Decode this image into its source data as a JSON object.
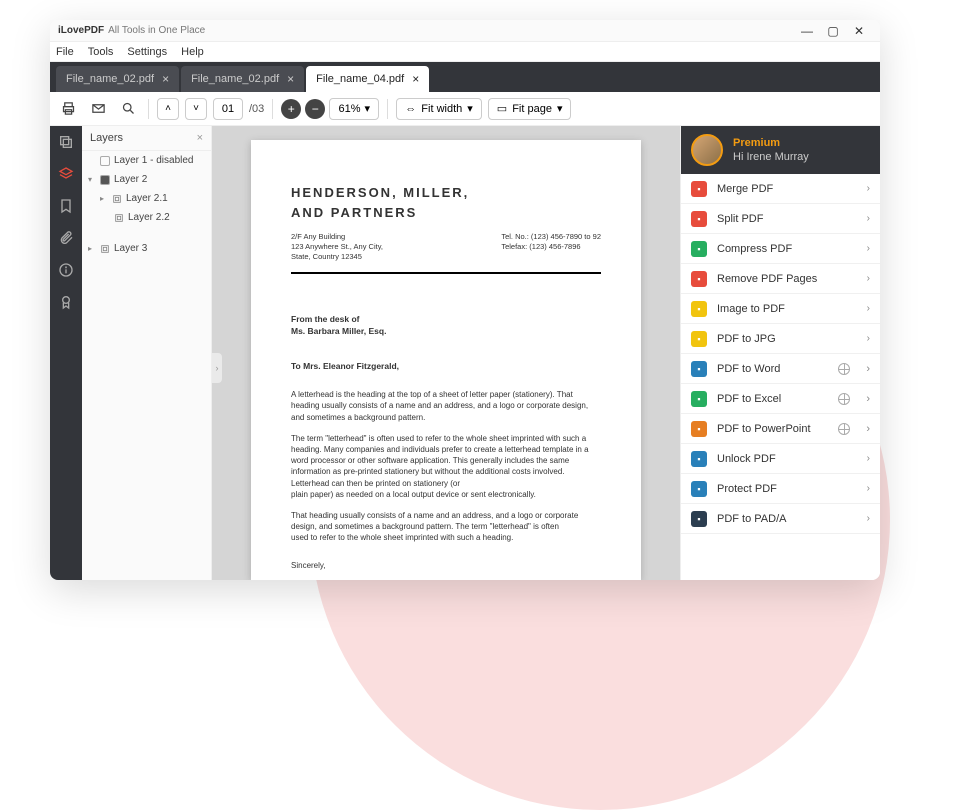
{
  "titlebar": {
    "app": "iLovePDF",
    "subtitle": "All Tools in One Place"
  },
  "menubar": [
    "File",
    "Tools",
    "Settings",
    "Help"
  ],
  "tabs": [
    {
      "label": "File_name_02.pdf",
      "active": false
    },
    {
      "label": "File_name_02.pdf",
      "active": false
    },
    {
      "label": "File_name_04.pdf",
      "active": true
    }
  ],
  "toolbar": {
    "page_current": "01",
    "page_total": "/03",
    "zoom": "61%",
    "fit_width": "Fit width",
    "fit_page": "Fit page"
  },
  "layers": {
    "title": "Layers",
    "items": [
      {
        "label": "Layer 1 - disabled",
        "level": 0,
        "checked": false,
        "expandable": false
      },
      {
        "label": "Layer 2",
        "level": 0,
        "checked": true,
        "expandable": true
      },
      {
        "label": "Layer 2.1",
        "level": 1,
        "checked": false,
        "icon": true,
        "expandable": true
      },
      {
        "label": "Layer 2.2",
        "level": 2,
        "checked": false,
        "icon": true,
        "expandable": false
      },
      {
        "label": "Layer 3",
        "level": 0,
        "checked": false,
        "icon": true,
        "expandable": true
      }
    ]
  },
  "document": {
    "h1": "HENDERSON, MILLER,",
    "h2": "AND PARTNERS",
    "addr_left": "2/F Any Building\n123 Anywhere St., Any City,\nState, Country 12345",
    "addr_right": "Tel. No.: (123) 456-7890 to 92\nTelefax: (123) 456-7896",
    "desk1": "From the desk of",
    "desk2": "Ms. Barbara Miller, Esq.",
    "to": "To Mrs. Eleanor Fitzgerald,",
    "p1": "A letterhead is the heading at the top of a sheet of letter paper (stationery). That heading usually consists of a name and an address, and a logo or corporate design, and sometimes a background pattern.",
    "p2": "The term \"letterhead\" is often used to refer to the whole sheet imprinted with such a heading. Many companies and individuals prefer to create a letterhead template in a word processor or other software application. This generally includes the same information as pre-printed stationery but without the additional costs involved. Letterhead can then be printed on stationery (or",
    "p3": "plain paper) as needed on a local output device or sent electronically.",
    "p4": "That heading usually consists of a name and an address, and a logo or corporate design, and sometimes a background pattern. The term \"letterhead\" is often",
    "p5": "used to refer to the whole sheet imprinted with such a heading.",
    "sign": "Sincerely,"
  },
  "user": {
    "premium": "Premium",
    "greeting": "Hi Irene Murray"
  },
  "tools": [
    {
      "label": "Merge PDF",
      "color": "#e74c3c",
      "globe": false
    },
    {
      "label": "Split PDF",
      "color": "#e74c3c",
      "globe": false
    },
    {
      "label": "Compress PDF",
      "color": "#27ae60",
      "globe": false
    },
    {
      "label": "Remove PDF Pages",
      "color": "#e74c3c",
      "globe": false
    },
    {
      "label": "Image to PDF",
      "color": "#f1c40f",
      "globe": false
    },
    {
      "label": "PDF to JPG",
      "color": "#f1c40f",
      "globe": false
    },
    {
      "label": "PDF to Word",
      "color": "#2980b9",
      "globe": true
    },
    {
      "label": "PDF to Excel",
      "color": "#27ae60",
      "globe": true
    },
    {
      "label": "PDF to PowerPoint",
      "color": "#e67e22",
      "globe": true
    },
    {
      "label": "Unlock PDF",
      "color": "#2980b9",
      "globe": false
    },
    {
      "label": "Protect PDF",
      "color": "#2980b9",
      "globe": false
    },
    {
      "label": "PDF to PAD/A",
      "color": "#2c3e50",
      "globe": false
    }
  ]
}
